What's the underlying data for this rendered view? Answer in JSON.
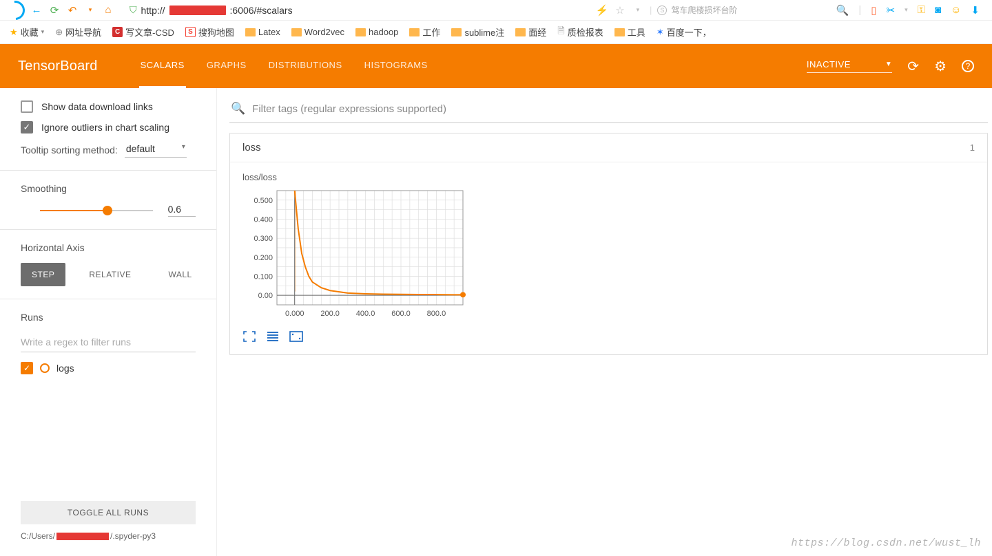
{
  "browser": {
    "url_prefix": "http://",
    "url_port_path": ":6006/#scalars",
    "search_hint": "驾车爬楼损坏台阶"
  },
  "bookmarks": {
    "fav": "收藏",
    "nav": "网址导航",
    "csdn": "写文章-CSD",
    "csdn_badge": "C",
    "sogou": "搜狗地图",
    "sogou_badge": "S",
    "latex": "Latex",
    "w2v": "Word2vec",
    "hadoop": "hadoop",
    "work": "工作",
    "sublime": "sublime注",
    "mianjing": "面经",
    "qc": "质检报表",
    "tools": "工具",
    "baidu": "百度一下，"
  },
  "header": {
    "brand": "TensorBoard",
    "tabs": [
      "SCALARS",
      "GRAPHS",
      "DISTRIBUTIONS",
      "HISTOGRAMS"
    ],
    "status": "INACTIVE"
  },
  "sidebar": {
    "show_dl": "Show data download links",
    "ignore_out": "Ignore outliers in chart scaling",
    "tooltip_label": "Tooltip sorting method:",
    "tooltip_value": "default",
    "smoothing_label": "Smoothing",
    "smoothing_value": "0.6",
    "hax_label": "Horizontal Axis",
    "hax_btns": [
      "STEP",
      "RELATIVE",
      "WALL"
    ],
    "runs_label": "Runs",
    "runs_filter_ph": "Write a regex to filter runs",
    "run0": "logs",
    "toggle_all": "TOGGLE ALL RUNS",
    "logdir_prefix": "C:/Users/",
    "logdir_suffix": "/.spyder-py3"
  },
  "content": {
    "filter_ph": "Filter tags (regular expressions supported)",
    "group_name": "loss",
    "group_count": "1",
    "chart_title": "loss/loss"
  },
  "chart_data": {
    "type": "line",
    "title": "loss/loss",
    "xlabel": "",
    "ylabel": "",
    "xlim": [
      -100,
      950
    ],
    "ylim": [
      -0.05,
      0.55
    ],
    "x_ticks": [
      0,
      200,
      400,
      600,
      800
    ],
    "x_tick_labels": [
      "0.000",
      "200.0",
      "400.0",
      "600.0",
      "800.0"
    ],
    "y_ticks": [
      0,
      0.1,
      0.2,
      0.3,
      0.4,
      0.5
    ],
    "y_tick_labels": [
      "0.00",
      "0.100",
      "0.200",
      "0.300",
      "0.400",
      "0.500"
    ],
    "series": [
      {
        "name": "logs",
        "color": "#f57c00",
        "x": [
          0,
          20,
          40,
          60,
          80,
          100,
          150,
          200,
          300,
          400,
          500,
          600,
          700,
          800,
          900,
          950
        ],
        "y": [
          0.55,
          0.35,
          0.22,
          0.15,
          0.1,
          0.07,
          0.04,
          0.025,
          0.012,
          0.008,
          0.006,
          0.005,
          0.004,
          0.004,
          0.003,
          0.003
        ]
      }
    ],
    "end_point": {
      "x": 950,
      "y": 0.003
    }
  },
  "watermark": "https://blog.csdn.net/wust_lh"
}
